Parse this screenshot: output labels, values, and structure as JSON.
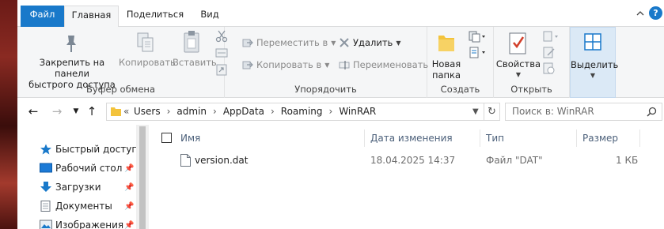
{
  "tabs": {
    "file": "Файл",
    "home": "Главная",
    "share": "Поделиться",
    "view": "Вид"
  },
  "ribbon": {
    "clipboard": {
      "label": "Буфер обмена",
      "pin_line1": "Закрепить на панели",
      "pin_line2": "быстрого доступа",
      "copy": "Копировать",
      "paste": "Вставить"
    },
    "organize": {
      "label": "Упорядочить",
      "move_to": "Переместить в",
      "copy_to": "Копировать в",
      "delete": "Удалить",
      "rename": "Переименовать"
    },
    "new": {
      "label": "Создать",
      "new_folder_line1": "Новая",
      "new_folder_line2": "папка"
    },
    "open": {
      "label": "Открыть",
      "properties": "Свойства"
    },
    "select": {
      "label": "Выделить"
    }
  },
  "address": {
    "segments": [
      "Users",
      "admin",
      "AppData",
      "Roaming",
      "WinRAR"
    ],
    "overflow": "«"
  },
  "search": {
    "placeholder": "Поиск в: WinRAR"
  },
  "navpane": {
    "quick_access": "Быстрый доступ",
    "items": [
      {
        "label": "Рабочий стол",
        "icon": "desktop-icon"
      },
      {
        "label": "Загрузки",
        "icon": "downloads-icon"
      },
      {
        "label": "Документы",
        "icon": "documents-icon"
      },
      {
        "label": "Изображения",
        "icon": "pictures-icon"
      }
    ]
  },
  "columns": {
    "name": "Имя",
    "date": "Дата изменения",
    "type": "Тип",
    "size": "Размер"
  },
  "files": [
    {
      "name": "version.dat",
      "date": "18.04.2025 14:37",
      "type": "Файл \"DAT\"",
      "size": "1 КБ"
    }
  ],
  "colors": {
    "file_tab": "#1979ca",
    "ribbon_bg": "#f5f6f7",
    "folder": "#f3c33c",
    "accent_blue": "#1979ca"
  }
}
